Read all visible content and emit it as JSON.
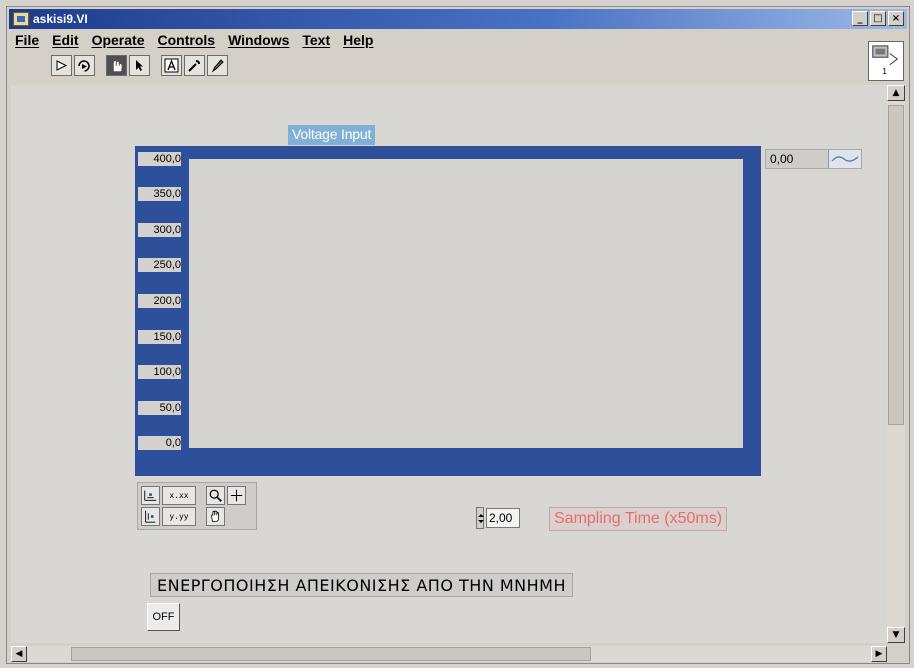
{
  "window": {
    "title": "askisi9.VI",
    "buttons": {
      "minimize": "_",
      "maximize": "□",
      "close": "×"
    }
  },
  "menu": [
    {
      "label": "File"
    },
    {
      "label": "Edit"
    },
    {
      "label": "Operate"
    },
    {
      "label": "Controls"
    },
    {
      "label": "Windows"
    },
    {
      "label": "Text"
    },
    {
      "label": "Help"
    }
  ],
  "toolbar": {
    "icons": [
      "run-icon",
      "run-continuously-icon",
      "operate-tool-icon",
      "positioning-tool-icon",
      "labeling-tool-icon",
      "wiring-tool-icon",
      "coloring-tool-icon"
    ]
  },
  "connector_icon": {
    "number": "1"
  },
  "graph": {
    "label": "Voltage Input",
    "y_ticks": [
      "400,0",
      "350,0",
      "300,0",
      "250,0",
      "200,0",
      "150,0",
      "100,0",
      "50,0",
      "0,0"
    ],
    "legend": {
      "value": "0,00"
    },
    "colors": {
      "frame": "#2e509b",
      "plot_bg": "#d5d3d0",
      "label_bg": "#7fb0d6"
    }
  },
  "chart_data": {
    "type": "line",
    "title": "Voltage Input",
    "ylim": [
      0,
      400
    ],
    "series": []
  },
  "palette": {
    "buttons": [
      "x-autoscale-icon",
      "x-format-icon",
      "zoom-icon",
      "crosshair-icon",
      "y-autoscale-icon",
      "y-format-icon",
      "pan-hand-icon"
    ],
    "x_format": "x.xx",
    "y_format": "y.yy"
  },
  "sampling": {
    "value": "2,00",
    "label": "Sampling Time (x50ms)",
    "label_color": "#e36f6a"
  },
  "memory_display": {
    "label": "ΕΝΕΡΓΟΠΟΙΗΣΗ ΑΠΕΙΚΟΝΙΣΗΣ ΑΠΟ ΤΗΝ ΜΝΗΜΗ",
    "button": "OFF"
  }
}
